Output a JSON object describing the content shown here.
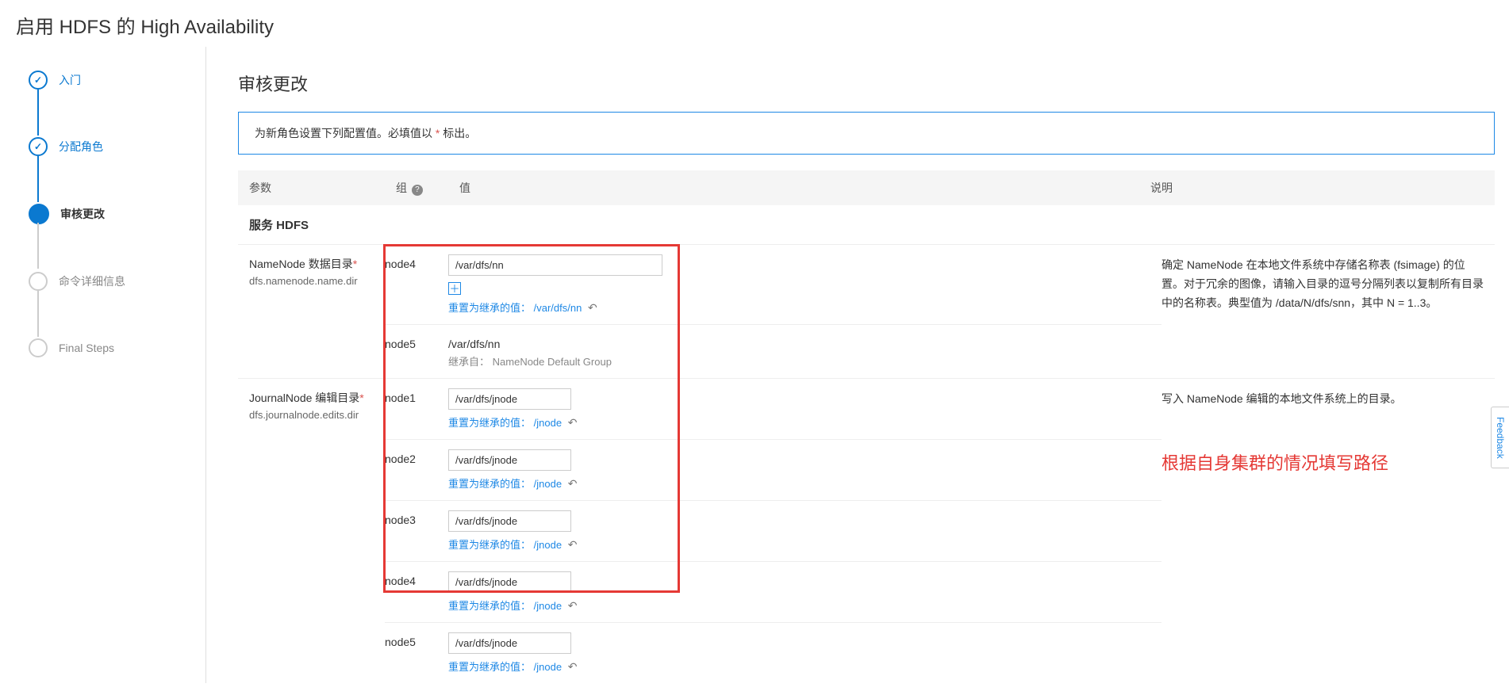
{
  "page_title": "启用 HDFS 的 High Availability",
  "sidebar": {
    "steps": [
      {
        "label": "入门",
        "state": "done"
      },
      {
        "label": "分配角色",
        "state": "done"
      },
      {
        "label": "审核更改",
        "state": "current"
      },
      {
        "label": "命令详细信息",
        "state": "pending"
      },
      {
        "label": "Final Steps",
        "state": "pending"
      }
    ]
  },
  "main": {
    "title": "审核更改",
    "notice_prefix": "为新角色设置下列配置值。必填值以 ",
    "notice_suffix": " 标出。",
    "headers": {
      "param": "参数",
      "group": "组",
      "value": "值",
      "desc": "说明"
    },
    "service_label": "服务 HDFS",
    "params": [
      {
        "name": "NameNode 数据目录",
        "required": true,
        "key": "dfs.namenode.name.dir",
        "desc": "确定 NameNode 在本地文件系统中存储名称表 (fsimage) 的位置。对于冗余的图像，请输入目录的逗号分隔列表以复制所有目录中的名称表。典型值为 /data/N/dfs/snn，其中 N = 1..3。",
        "rows": [
          {
            "group": "node4",
            "type": "input-wide",
            "value": "/var/dfs/nn",
            "add": true,
            "reset_label": "重置为继承的值：",
            "reset_value": "/var/dfs/nn"
          },
          {
            "group": "node5",
            "type": "static",
            "value": "/var/dfs/nn",
            "inherit_label": "继承自：",
            "inherit_from": "NameNode Default Group"
          }
        ]
      },
      {
        "name": "JournalNode 编辑目录",
        "required": true,
        "key": "dfs.journalnode.edits.dir",
        "desc": "写入 NameNode 编辑的本地文件系统上的目录。",
        "annotation": "根据自身集群的情况填写路径",
        "rows": [
          {
            "group": "node1",
            "type": "input",
            "value": "/var/dfs/jnode",
            "reset_label": "重置为继承的值：",
            "reset_value": "/jnode"
          },
          {
            "group": "node2",
            "type": "input",
            "value": "/var/dfs/jnode",
            "reset_label": "重置为继承的值：",
            "reset_value": "/jnode"
          },
          {
            "group": "node3",
            "type": "input",
            "value": "/var/dfs/jnode",
            "reset_label": "重置为继承的值：",
            "reset_value": "/jnode"
          },
          {
            "group": "node4",
            "type": "input",
            "value": "/var/dfs/jnode",
            "reset_label": "重置为继承的值：",
            "reset_value": "/jnode"
          },
          {
            "group": "node5",
            "type": "input",
            "value": "/var/dfs/jnode",
            "reset_label": "重置为继承的值：",
            "reset_value": "/jnode"
          }
        ]
      }
    ]
  },
  "feedback_label": "Feedback"
}
